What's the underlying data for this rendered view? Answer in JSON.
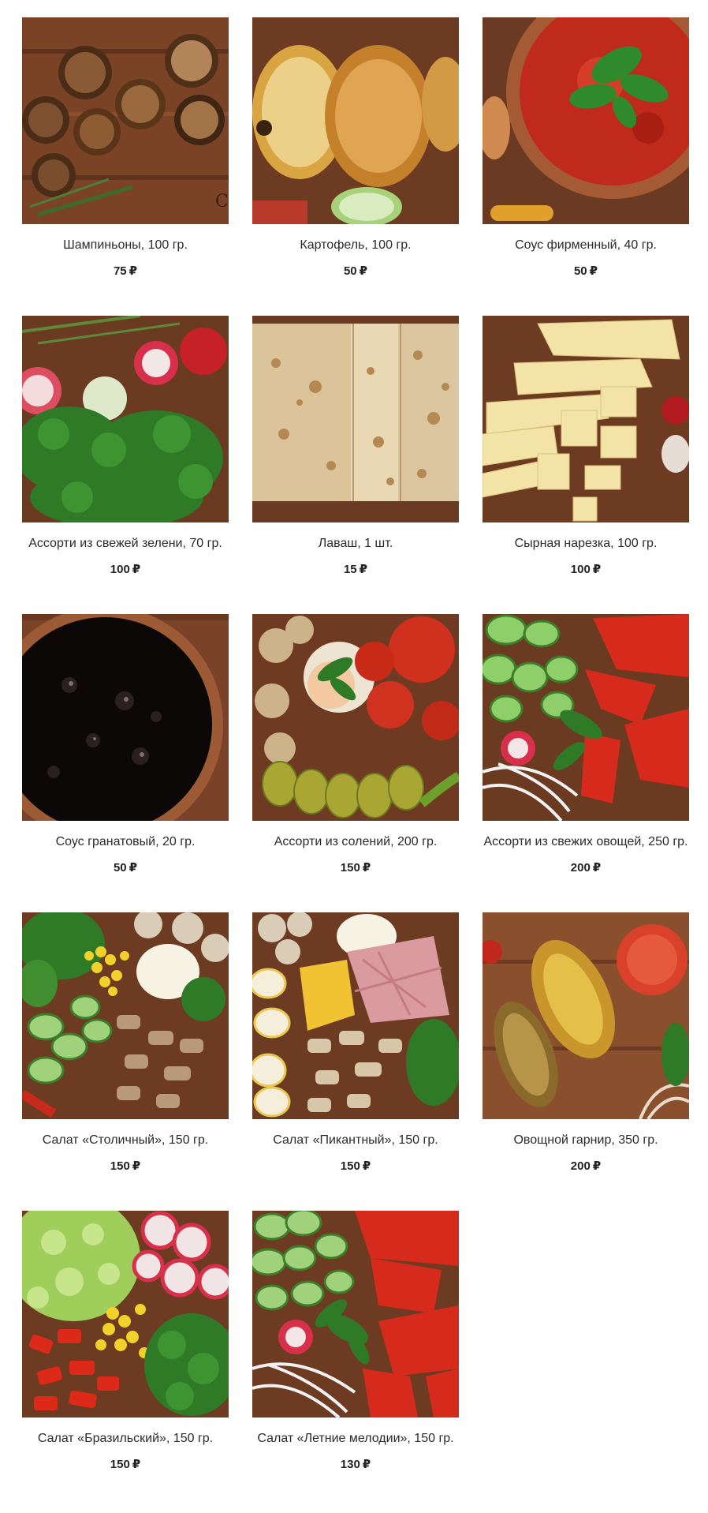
{
  "currency": "₽",
  "products": [
    {
      "name": "Шампиньоны, 100 гр.",
      "price": "75",
      "image": "mushrooms-photo"
    },
    {
      "name": "Картофель, 100 гр.",
      "price": "50",
      "image": "potato-photo"
    },
    {
      "name": "Соус фирменный, 40 гр.",
      "price": "50",
      "image": "tomato-sauce-photo"
    },
    {
      "name": "Ассорти из свежей зелени, 70 гр.",
      "price": "100",
      "image": "greens-photo"
    },
    {
      "name": "Лаваш, 1 шт.",
      "price": "15",
      "image": "lavash-photo"
    },
    {
      "name": "Сырная нарезка, 100 гр.",
      "price": "100",
      "image": "cheese-photo"
    },
    {
      "name": "Соус гранатовый, 20 гр.",
      "price": "50",
      "image": "pomegranate-sauce-photo"
    },
    {
      "name": "Ассорти из солений, 200 гр.",
      "price": "150",
      "image": "pickles-photo"
    },
    {
      "name": "Ассорти из свежих овощей, 250 гр.",
      "price": "200",
      "image": "fresh-vegetables-photo"
    },
    {
      "name": "Салат «Столичный», 150 гр.",
      "price": "150",
      "image": "salad-stolichny-photo"
    },
    {
      "name": "Салат «Пикантный», 150 гр.",
      "price": "150",
      "image": "salad-pikantny-photo"
    },
    {
      "name": "Овощной гарнир, 350 гр.",
      "price": "200",
      "image": "vegetable-garnish-photo"
    },
    {
      "name": "Салат «Бразильский», 150 гр.",
      "price": "150",
      "image": "salad-brazilsky-photo"
    },
    {
      "name": "Салат «Летние мелодии», 150 гр.",
      "price": "130",
      "image": "salad-summer-photo"
    }
  ]
}
